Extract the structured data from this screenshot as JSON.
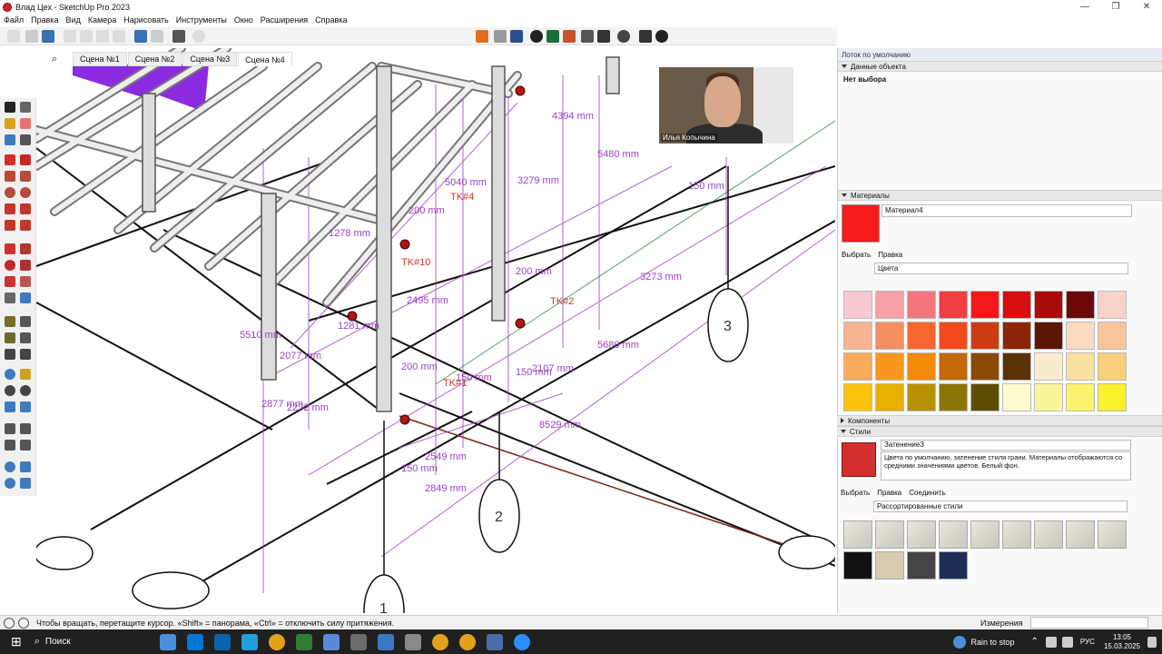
{
  "window": {
    "title": "Влад Цех - SketchUp Pro 2023"
  },
  "menu": [
    "Файл",
    "Правка",
    "Вид",
    "Камера",
    "Нарисовать",
    "Инструменты",
    "Окно",
    "Расширения",
    "Справка"
  ],
  "scene_tabs": [
    "Сцена №1",
    "Сцена №2",
    "Сцена №3",
    "Сцена №4"
  ],
  "video": {
    "name": "Илья Копычина"
  },
  "model_labels": {
    "dims": [
      "4394 mm",
      "5480 mm",
      "5040 mm",
      "3279 mm",
      "200 mm",
      "1278 mm",
      "3273 mm",
      "200 mm",
      "2495 mm",
      "1281 mm",
      "5510 mm",
      "2077 mm",
      "200 mm",
      "5680 mm",
      "2107 mm",
      "150 mm",
      "150 mm",
      "2877 mm",
      "2232 mm",
      "8529 mm",
      "2549 mm",
      "150 mm",
      "2849 mm",
      "150 mm"
    ],
    "tags": [
      "TK#4",
      "TK#10",
      "TK#2",
      "TK#1"
    ],
    "axes": [
      "3",
      "2",
      "1"
    ]
  },
  "tray": {
    "title": "Лоток по умолчанию",
    "entity_info": {
      "label": "Данные объекта",
      "value": "Нет выбора"
    },
    "materials": {
      "label": "Материалы",
      "name": "Материал4",
      "tabs": [
        "Выбрать",
        "Правка"
      ],
      "library": "Цвета",
      "swatches": [
        "#f9c9d2",
        "#f7a1a8",
        "#f2767c",
        "#f03f45",
        "#f6171a",
        "#d90d0f",
        "#a70b0c",
        "#6b0808",
        "#fbd2c9",
        "#f7b393",
        "#f79061",
        "#f7672f",
        "#f34a1b",
        "#cc3d12",
        "#8c2609",
        "#5c1605",
        "#fbdac2",
        "#f8c59a",
        "#f9aa5a",
        "#f9981e",
        "#f28a0a",
        "#c46809",
        "#8b4a06",
        "#5a3205",
        "#fbecd0",
        "#fadf9f",
        "#f9cf79",
        "#fbc30a",
        "#e6b000",
        "#b89003",
        "#8b7506",
        "#5c4d03",
        "#fdfbcf",
        "#fbf59a",
        "#fbf26e",
        "#f9f12c"
      ]
    },
    "components": {
      "label": "Компоненты"
    },
    "styles": {
      "label": "Стили",
      "name": "Затенение3",
      "description": "Цвета по умолчанию, затенение стиля грани. Материалы отображаются со средними значениями цветов. Белый фон.",
      "tabs": [
        "Выбрать",
        "Правка",
        "Соединить"
      ],
      "library": "Рассортированные стили"
    }
  },
  "status": {
    "hint": "Чтобы вращать, перетащите курсор. «Shift» = панорама, «Ctrl» = отключить силу притяжения.",
    "measure_label": "Измерения"
  },
  "taskbar": {
    "search": "Поиск",
    "weather": "Rain to stop",
    "lang": "РУС",
    "time": "13:05",
    "date": "15.03.2025"
  }
}
